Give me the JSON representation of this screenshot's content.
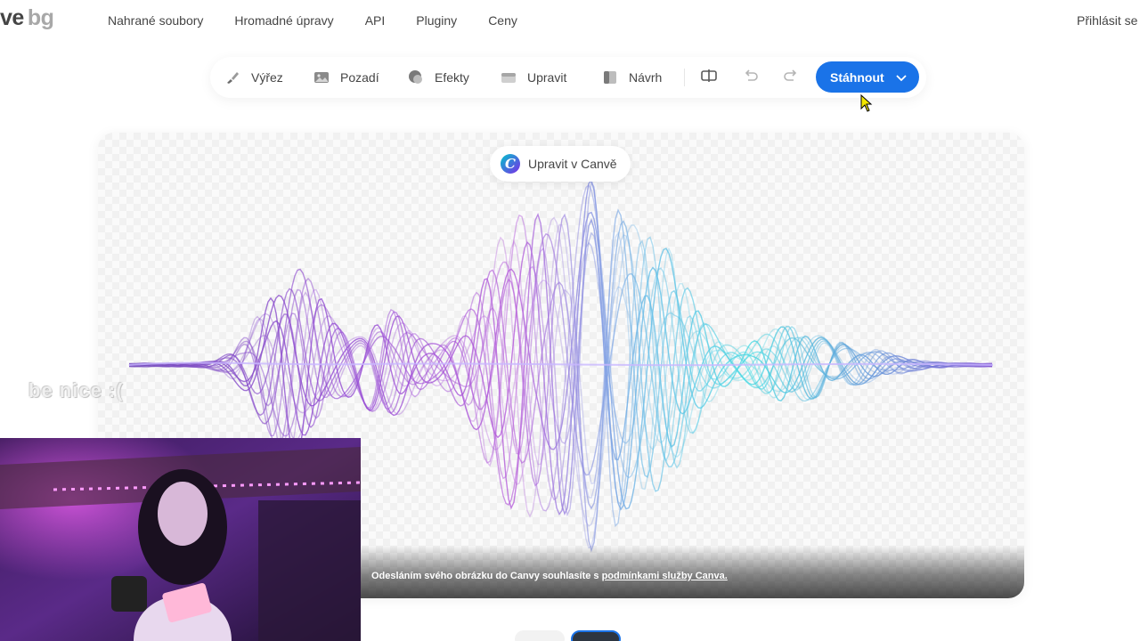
{
  "nav": {
    "logo_dark": "ve",
    "logo_light": "bg",
    "links": [
      "Nahrané soubory",
      "Hromadné úpravy",
      "API",
      "Pluginy",
      "Ceny"
    ],
    "login": "Přihlásit se"
  },
  "toolbar": {
    "tools": [
      {
        "label": "Výřez",
        "icon": "brush-icon"
      },
      {
        "label": "Pozadí",
        "icon": "image-icon"
      },
      {
        "label": "Efekty",
        "icon": "effects-icon"
      },
      {
        "label": "Upravit",
        "icon": "adjust-icon"
      },
      {
        "label": "Návrh",
        "icon": "design-icon"
      }
    ],
    "compare_icon": "compare-icon",
    "undo_icon": "undo-icon",
    "redo_icon": "redo-icon",
    "download_label": "Stáhnout",
    "accent_color": "#1a73e8"
  },
  "canvas": {
    "canva_button": "Upravit v Canvě",
    "consent_prefix": "Odesláním svého obrázku do Canvy souhlasíte s ",
    "consent_link": "podmínkami služby Canva."
  },
  "overlay": {
    "text": "be nice :("
  }
}
